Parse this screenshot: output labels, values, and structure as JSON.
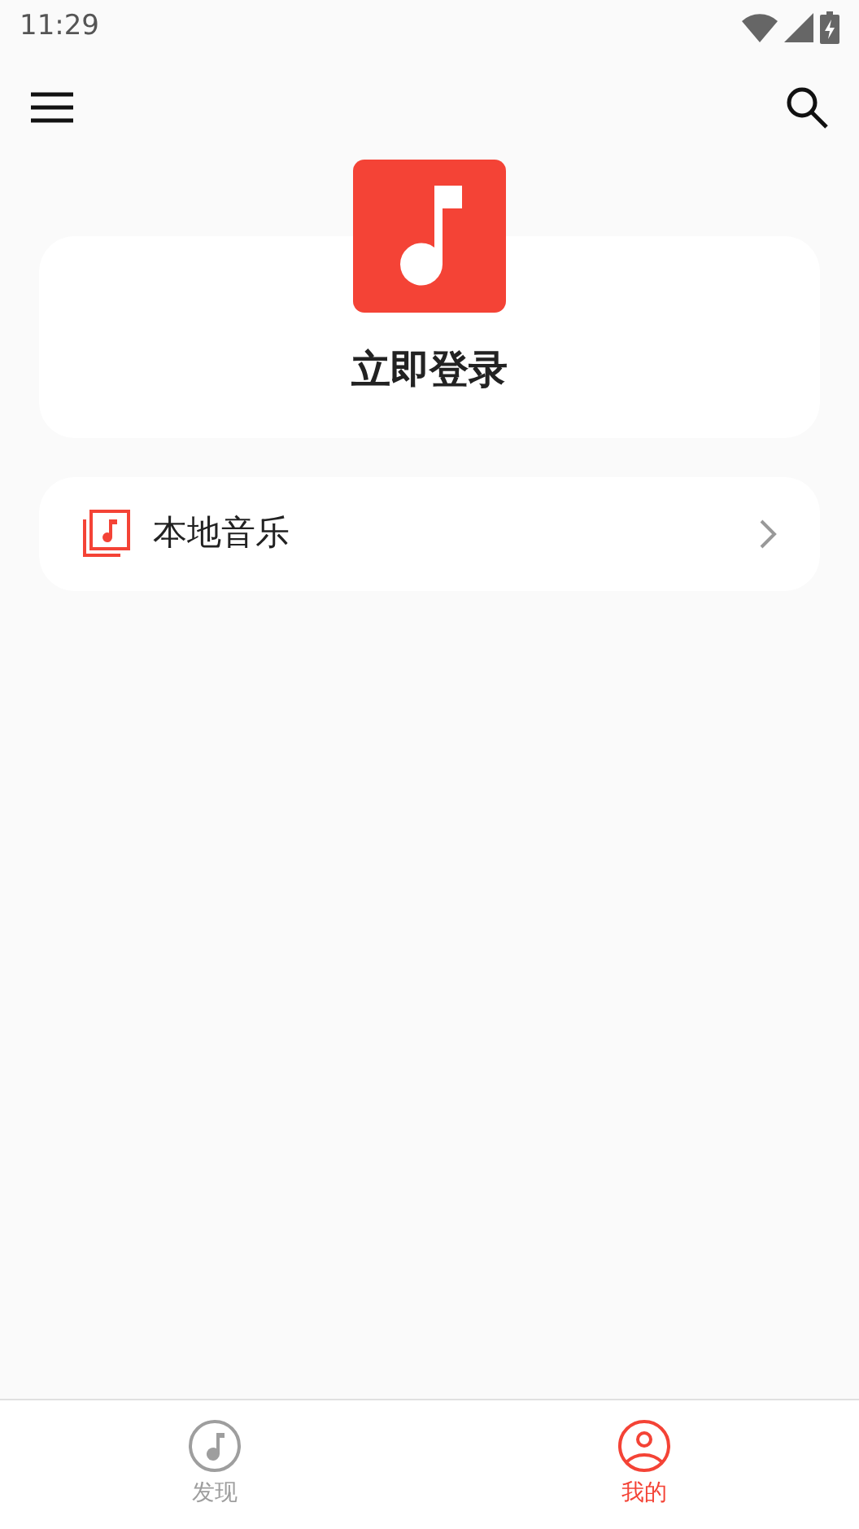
{
  "status_bar": {
    "time": "11:29"
  },
  "login_card": {
    "title": "立即登录"
  },
  "menu_items": [
    {
      "label": "本地音乐"
    }
  ],
  "bottom_nav": [
    {
      "label": "发现",
      "kind": "music",
      "selected": false
    },
    {
      "label": "我的",
      "kind": "profile",
      "selected": true
    }
  ]
}
